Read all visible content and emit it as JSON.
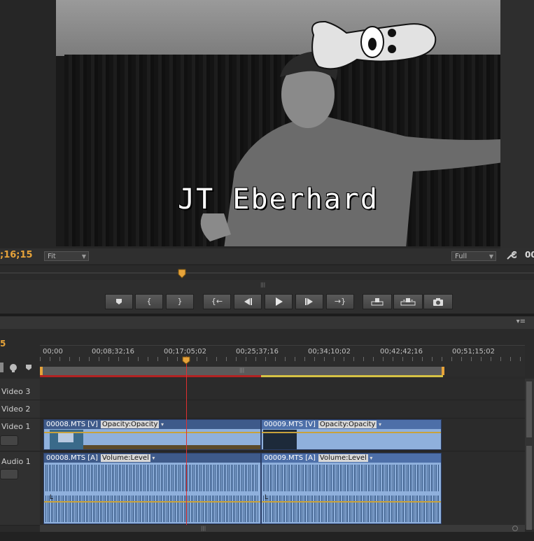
{
  "monitor": {
    "overlay_title": "JT Eberhard",
    "timecode": ";16;15",
    "fit_label": "Fit",
    "quality_label": "Full",
    "right_timecode": "00",
    "wrench": "wrench-icon"
  },
  "transport": {
    "buttons": [
      {
        "name": "add-marker-button",
        "icon": "marker-icon"
      },
      {
        "name": "mark-in-button",
        "label": "{"
      },
      {
        "name": "mark-out-button",
        "label": "}"
      },
      {
        "name": "go-to-in-button",
        "label": "{←"
      },
      {
        "name": "step-back-button",
        "icon": "step-back-icon"
      },
      {
        "name": "play-button",
        "icon": "play-icon"
      },
      {
        "name": "step-forward-button",
        "icon": "step-forward-icon"
      },
      {
        "name": "go-to-out-button",
        "label": "→}"
      },
      {
        "name": "lift-button",
        "icon": "lift-icon"
      },
      {
        "name": "extract-button",
        "icon": "extract-icon"
      },
      {
        "name": "export-frame-button",
        "icon": "camera-icon"
      }
    ]
  },
  "timeline": {
    "timecode": "5",
    "ruler_labels": [
      "00;00",
      "00;08;32;16",
      "00;17;05;02",
      "00;25;37;16",
      "00;34;10;02",
      "00;42;42;16",
      "00;51;15;02"
    ],
    "tracks": [
      {
        "label": "Video 3"
      },
      {
        "label": "Video 2"
      },
      {
        "label": "Video 1"
      },
      {
        "label": "Audio 1"
      }
    ],
    "clips": {
      "v1a_name": "00008.MTS [V]",
      "v1a_fx": "Opacity:Opacity",
      "v1b_name": "00009.MTS [V]",
      "v1b_fx": "Opacity:Opacity",
      "a1a_name": "00008.MTS [A]",
      "a1a_fx": "Volume:Level",
      "a1b_name": "00009.MTS [A]",
      "a1b_fx": "Volume:Level",
      "channel_label": "L"
    }
  },
  "colors": {
    "timecode": "#e6a33a",
    "playhead": "#e03030",
    "clip": "#8fb0dc"
  }
}
